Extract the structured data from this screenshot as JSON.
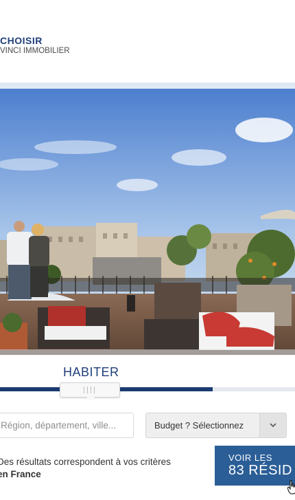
{
  "brand": {
    "title": "CHOISIR",
    "subtitle": "VINCI IMMOBILIER"
  },
  "hero": {
    "image": "rooftop-terrace-paris-photo"
  },
  "tab": {
    "label": "HABITER"
  },
  "slider": {
    "value_fraction": 0.72
  },
  "search": {
    "placeholder": "Région, département, ville..."
  },
  "budget": {
    "label": "Budget ? Sélectionnez",
    "icon": "chevron-down-icon"
  },
  "results": {
    "line1": "Des résultats correspondent à vos critères",
    "line2": "en France"
  },
  "cta": {
    "line1": "VOIR LES",
    "line2": "83 RÉSID"
  },
  "colors": {
    "brand": "#1f3f7a",
    "cta": "#2b5e97",
    "track": "#1b3b72"
  }
}
